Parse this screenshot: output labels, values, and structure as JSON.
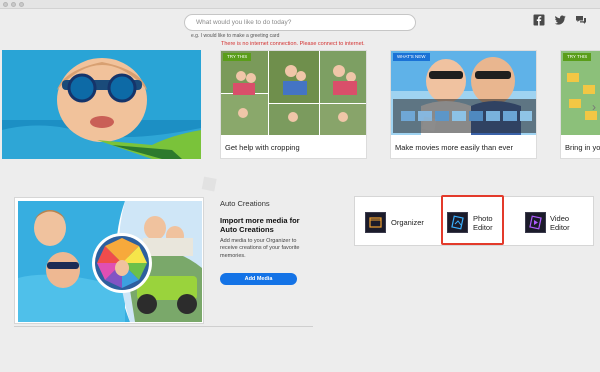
{
  "search": {
    "placeholder": "What would you like to do today?",
    "hint": "e.g. I would like to make a greeting card",
    "error": "There is no internet connection. Please connect to internet."
  },
  "header_icons": [
    "facebook-icon",
    "twitter-icon",
    "chat-icon"
  ],
  "carousel": {
    "cards": [
      {
        "tag": "TRY THIS",
        "label": "Get help with cropping"
      },
      {
        "tag": "WHAT'S NEW",
        "label": "Make movies more easily than ever"
      },
      {
        "tag": "TRY THIS",
        "label": "Bring in you"
      }
    ]
  },
  "auto_creations": {
    "title": "Auto Creations",
    "heading": "Import more media for Auto Creations",
    "description": "Add media to your Organizer to receive creations of your favorite memories.",
    "button": "Add Media"
  },
  "apps": [
    {
      "label": "Organizer"
    },
    {
      "label": "Photo Editor"
    },
    {
      "label": "Video Editor"
    }
  ],
  "colors": {
    "accent_blue": "#1473e6",
    "error_red": "#d3302f",
    "selected_outline": "#e33a2b",
    "tag_green": "#5a9e1a",
    "tag_blue": "#1a72d6"
  }
}
